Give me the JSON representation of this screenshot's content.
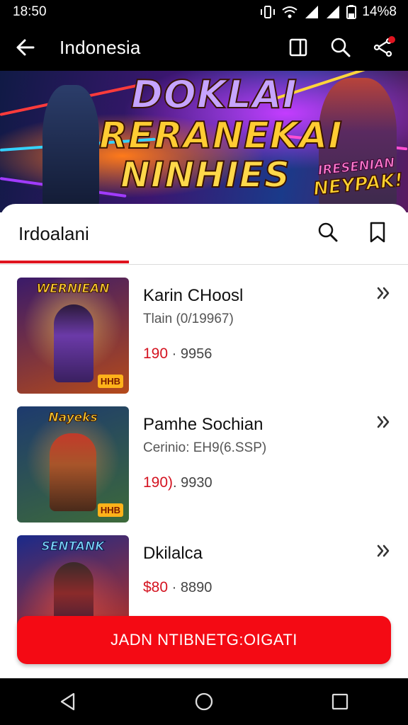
{
  "status_bar": {
    "time": "18:50",
    "battery": "14%8"
  },
  "app_bar": {
    "title": "Indonesia"
  },
  "banner": {
    "title_line1": "DOKLAI",
    "title_line2": "RERANEKAI",
    "title_line3": "NINHIES",
    "tag_line1": "IRESENIAN",
    "tag_line2": "NEYPAK!"
  },
  "sheet": {
    "title": "Irdoalani"
  },
  "items": [
    {
      "name": "Karin CHoosl",
      "subtitle": "Tlain (0/19967)",
      "price_strong": "190",
      "price_rest": " · 9956",
      "thumb_title": "WERNIEAN",
      "thumb_badge": "HHB",
      "colors": {
        "bg1": "#3a1a6a",
        "bg2": "#b54a1a",
        "hero": "#6b3aa8"
      }
    },
    {
      "name": "Pamhe Sochian",
      "subtitle": "Cerinio: EH9(6.SSP)",
      "price_strong": "190)",
      "price_rest": ". 9930",
      "thumb_title": "Nayeks",
      "thumb_badge": "HHB",
      "colors": {
        "bg1": "#1d3a6e",
        "bg2": "#3d6a3a",
        "hero": "#a8552a"
      }
    },
    {
      "name": "Dkilalca",
      "subtitle": "",
      "price_strong": "$80",
      "price_rest": " · 8890",
      "thumb_title": "SENTANK",
      "thumb_badge": "",
      "colors": {
        "bg1": "#1a2a8a",
        "bg2": "#c8321a",
        "hero": "#8a2a2a"
      }
    }
  ],
  "cta": {
    "label": "JADN NTIBNETG:OIGATI"
  },
  "colors": {
    "accent": "#e0141f",
    "cta": "#f40a14",
    "bar": "#000000"
  }
}
